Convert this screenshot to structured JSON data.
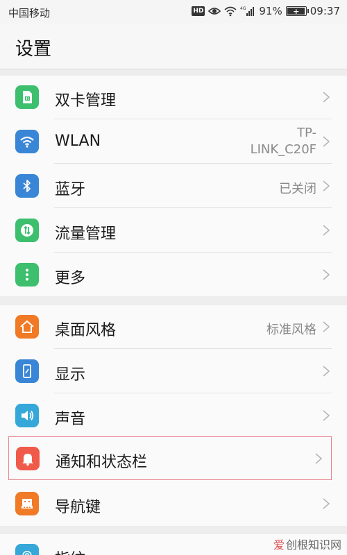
{
  "status_bar": {
    "carrier": "中国移动",
    "hd": "HD",
    "network": "4G",
    "battery_percent": "91%",
    "battery_level": 0.91,
    "time": "09:37"
  },
  "header": {
    "title": "设置"
  },
  "groups": [
    {
      "items": [
        {
          "label": "双卡管理",
          "value": "",
          "icon": "sim-card-icon",
          "color": "#3dbf6e"
        },
        {
          "label": "WLAN",
          "value_line1": "TP-",
          "value_line2": "LINK_C20F",
          "icon": "wifi-icon",
          "color": "#3a86d6"
        },
        {
          "label": "蓝牙",
          "value": "已关闭",
          "icon": "bluetooth-icon",
          "color": "#3a86d6"
        },
        {
          "label": "流量管理",
          "value": "",
          "icon": "data-usage-icon",
          "color": "#3dbf6e"
        },
        {
          "label": "更多",
          "value": "",
          "icon": "more-icon",
          "color": "#3dbf6e"
        }
      ]
    },
    {
      "items": [
        {
          "label": "桌面风格",
          "value": "标准风格",
          "icon": "home-icon",
          "color": "#f07a26"
        },
        {
          "label": "显示",
          "value": "",
          "icon": "display-icon",
          "color": "#3a86d6"
        },
        {
          "label": "声音",
          "value": "",
          "icon": "speaker-icon",
          "color": "#35a7d8"
        },
        {
          "label": "通知和状态栏",
          "value": "",
          "icon": "bell-icon",
          "color": "#f05a4a"
        },
        {
          "label": "导航键",
          "value": "",
          "icon": "navigation-keys-icon",
          "color": "#f07a26"
        }
      ]
    },
    {
      "items": [
        {
          "label": "指纹",
          "value": "",
          "icon": "fingerprint-icon",
          "color": "#35a7d8"
        }
      ]
    }
  ],
  "watermark": {
    "text_accent": "爱",
    "text_rest": "创根知识网"
  }
}
